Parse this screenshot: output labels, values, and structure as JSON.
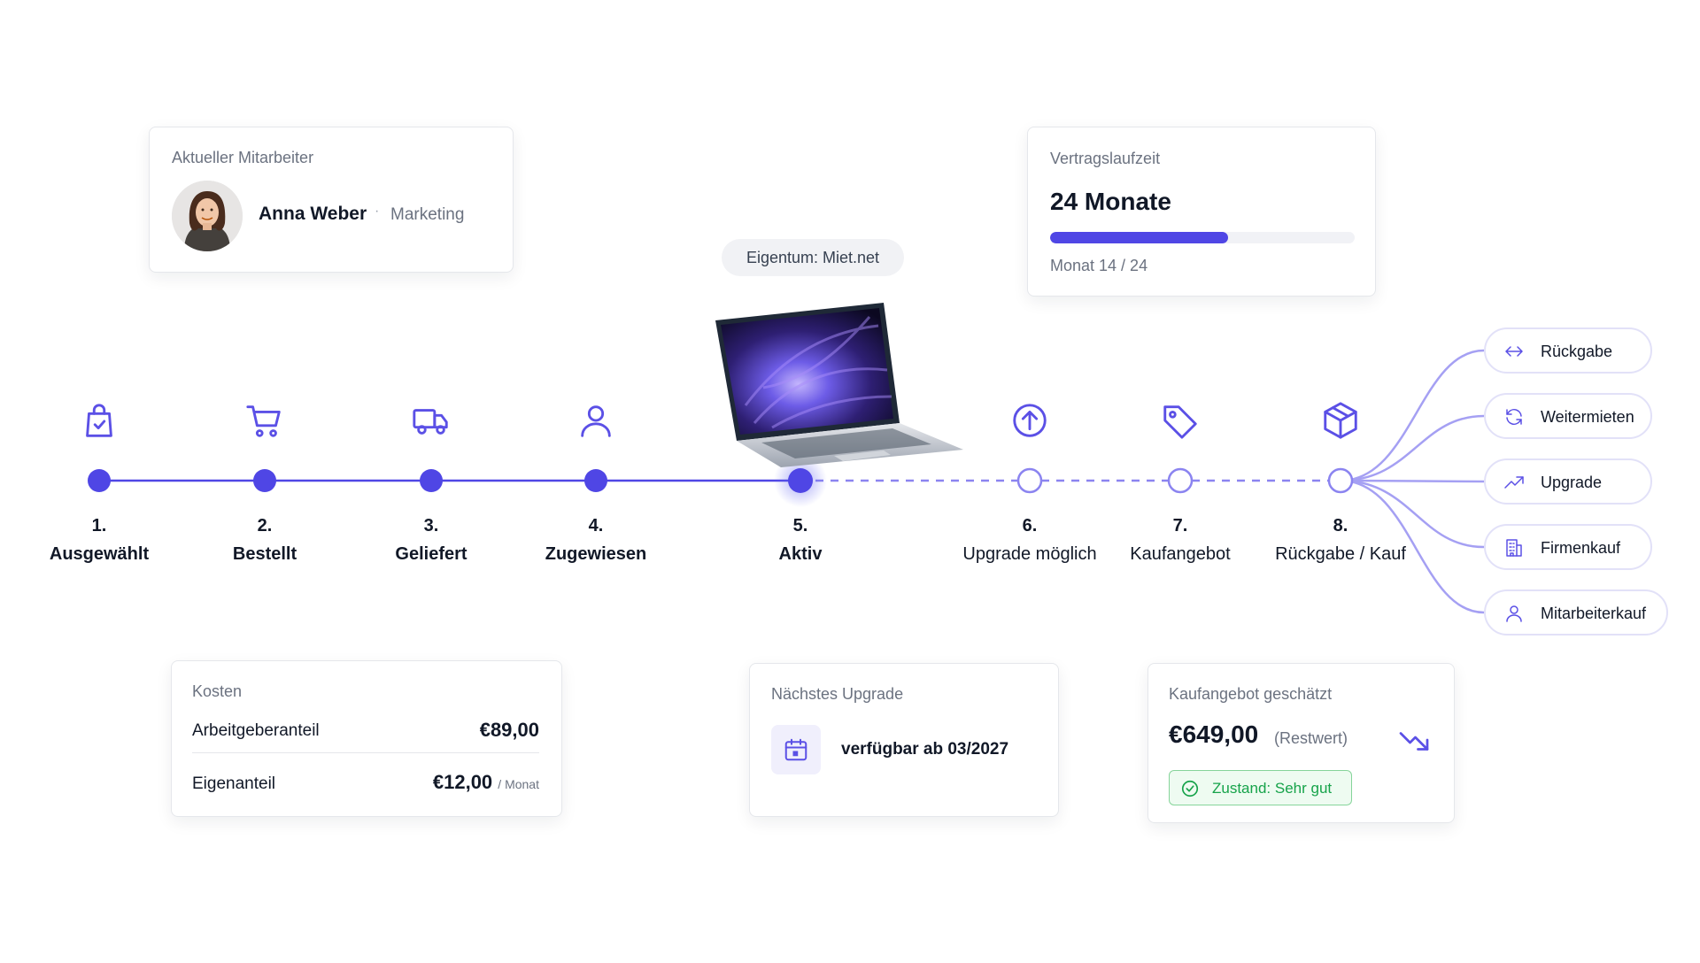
{
  "employee_card": {
    "label": "Aktueller Mitarbeiter",
    "name": "Anna Weber",
    "separator": "·",
    "department": "Marketing"
  },
  "contract_card": {
    "label": "Vertragslaufzeit",
    "value": "24 Monate",
    "progress_text": "Monat 14 / 24",
    "progress_fraction": 0.583
  },
  "ownership": {
    "text": "Eigentum: Miet.net"
  },
  "timeline": {
    "active_step": 5,
    "steps": [
      {
        "num": "1.",
        "label": "Ausgewählt",
        "icon": "shopping-bag-check-icon"
      },
      {
        "num": "2.",
        "label": "Bestellt",
        "icon": "cart-icon"
      },
      {
        "num": "3.",
        "label": "Geliefert",
        "icon": "truck-icon"
      },
      {
        "num": "4.",
        "label": "Zugewiesen",
        "icon": "user-icon"
      },
      {
        "num": "5.",
        "label": "Aktiv",
        "icon": "laptop-icon"
      },
      {
        "num": "6.",
        "label": "Upgrade möglich",
        "icon": "arrow-up-circle-icon"
      },
      {
        "num": "7.",
        "label": "Kaufangebot",
        "icon": "tag-icon"
      },
      {
        "num": "8.",
        "label": "Rückgabe / Kauf",
        "icon": "box-icon"
      }
    ]
  },
  "options": [
    {
      "label": "Rückgabe",
      "icon": "return-arrow-icon"
    },
    {
      "label": "Weitermieten",
      "icon": "refresh-icon"
    },
    {
      "label": "Upgrade",
      "icon": "trend-up-icon"
    },
    {
      "label": "Firmenkauf",
      "icon": "building-icon"
    },
    {
      "label": "Mitarbeiterkauf",
      "icon": "user-icon"
    }
  ],
  "cost_card": {
    "label": "Kosten",
    "employer_label": "Arbeitgeberanteil",
    "employer_amount": "€89,00",
    "own_label": "Eigenanteil",
    "own_amount": "€12,00",
    "own_unit": "/ Monat"
  },
  "upgrade_card": {
    "label": "Nächstes Upgrade",
    "text": "verfügbar ab 03/2027",
    "icon": "calendar-icon"
  },
  "buyout_card": {
    "label": "Kaufangebot geschätzt",
    "price": "€649,00",
    "sub": "(Restwert)",
    "trend_icon": "trend-down-icon",
    "condition": "Zustand: Sehr gut"
  },
  "colors": {
    "accent": "#4f46e5",
    "accent_light": "#8b84f0",
    "success": "#16a34a",
    "text": "#111827",
    "muted": "#6b7280"
  }
}
